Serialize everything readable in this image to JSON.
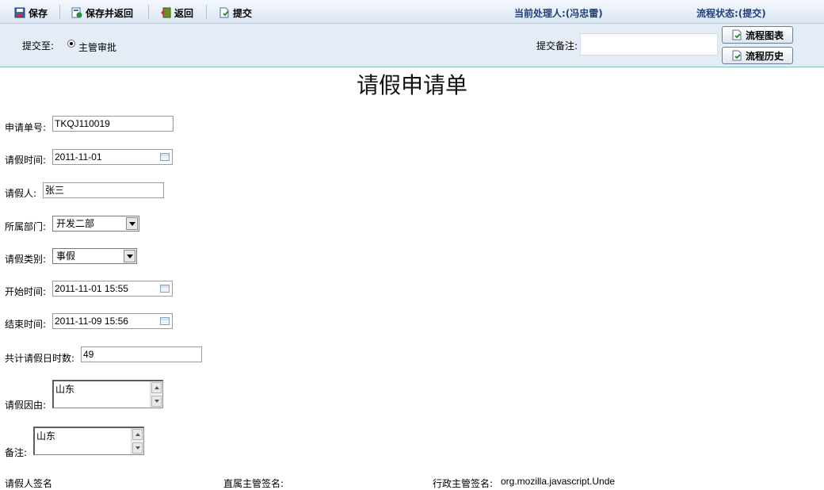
{
  "toolbar": {
    "save_label": "保存",
    "save_return_label": "保存并返回",
    "return_label": "返回",
    "submit_label": "提交",
    "current_handler": "当前处理人:(冯忠雷)",
    "flow_status": "流程状态:(提交)"
  },
  "submit_bar": {
    "submit_to_label": "提交至:",
    "radio_option": "主管审批",
    "memo_label": "提交备注:",
    "memo_value": "",
    "flow_chart_button": "流程图表",
    "flow_history_button": "流程历史"
  },
  "form": {
    "title": "请假申请单",
    "request_no_label": "申请单号:",
    "request_no": "TKQJ110019",
    "leave_date_label": "请假时间:",
    "leave_date": "2011-11-01",
    "applicant_label": "请假人:",
    "applicant": "张三",
    "department_label": "所属部门:",
    "department": "开发二部",
    "leave_type_label": "请假类别:",
    "leave_type": "事假",
    "start_time_label": "开始时间:",
    "start_time": "2011-11-01 15:55",
    "end_time_label": "结束时间:",
    "end_time": "2011-11-09 15:56",
    "total_hours_label": "共计请假日时数:",
    "total_hours": "49",
    "reason_label": "请假因由:",
    "reason": "山东",
    "remark_label": "备注:",
    "remark": "山东",
    "applicant_sign_label": "请假人签名",
    "direct_manager_sign_label": "直属主管签名:",
    "admin_manager_sign_label": "行政主管签名:",
    "admin_manager_sign_value": "org.mozilla.javascript.Unde"
  },
  "colors": {
    "toolbar_bg": "#dbe6f3",
    "status_text": "#1f3f7d",
    "submit_bar_bg": "#e4ecf6",
    "divider": "#7fc0b8"
  },
  "icons": [
    "save-icon",
    "save-return-icon",
    "return-icon",
    "submit-icon",
    "calendar-icon",
    "dropdown-arrow-icon",
    "flow-icon"
  ]
}
